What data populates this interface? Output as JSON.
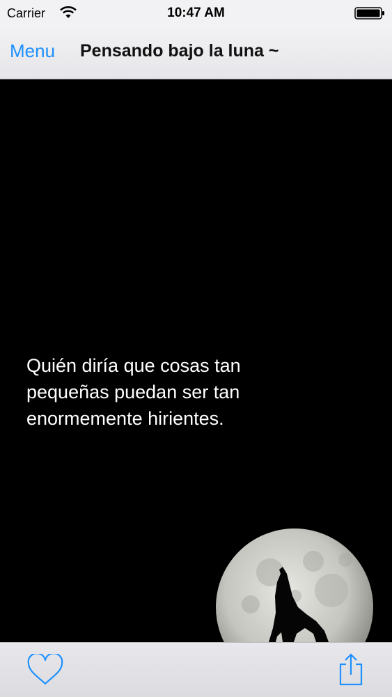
{
  "status_bar": {
    "carrier": "Carrier",
    "time": "10:47 AM"
  },
  "nav": {
    "menu_label": "Menu",
    "title": "Pensando bajo la luna ~"
  },
  "quote": {
    "text": "Quién diría que cosas tan pequeñas puedan ser tan enormemente hirientes."
  },
  "toolbar": {
    "favorite_icon": "heart-icon",
    "share_icon": "share-icon"
  },
  "colors": {
    "accent": "#1e90ff",
    "background": "#000000"
  }
}
